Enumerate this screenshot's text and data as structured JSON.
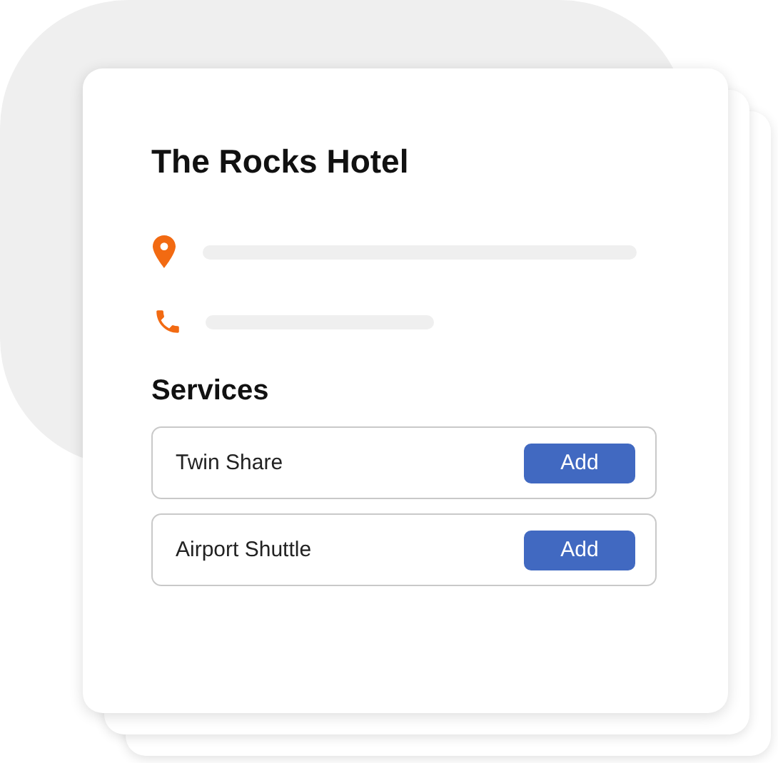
{
  "hotel": {
    "name": "The Rocks Hotel",
    "contacts": [
      {
        "kind": "location"
      },
      {
        "kind": "phone"
      }
    ],
    "services_heading": "Services",
    "services": [
      {
        "name": "Twin Share",
        "button": "Add"
      },
      {
        "name": "Airport Shuttle",
        "button": "Add"
      }
    ]
  }
}
